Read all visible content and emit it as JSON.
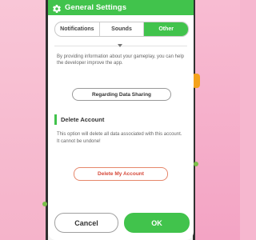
{
  "header": {
    "title": "General Settings",
    "icon": "gear-icon"
  },
  "tabs": [
    {
      "label": "Notifications",
      "active": false
    },
    {
      "label": "Sounds",
      "active": false
    },
    {
      "label": "Other",
      "active": true
    }
  ],
  "privacy": {
    "info": "By providing information about your gameplay, you can help the developer improve the app.",
    "button_label": "Regarding Data Sharing"
  },
  "delete_account": {
    "title": "Delete Account",
    "info": "This option will delete all data associated with this account. It cannot be undone!",
    "button_label": "Delete My Account"
  },
  "footer": {
    "cancel_label": "Cancel",
    "ok_label": "OK"
  },
  "colors": {
    "accent": "#41c34c",
    "danger": "#d6493a",
    "background_left": "#f8bfd2",
    "background_right": "#f6b7cf"
  }
}
